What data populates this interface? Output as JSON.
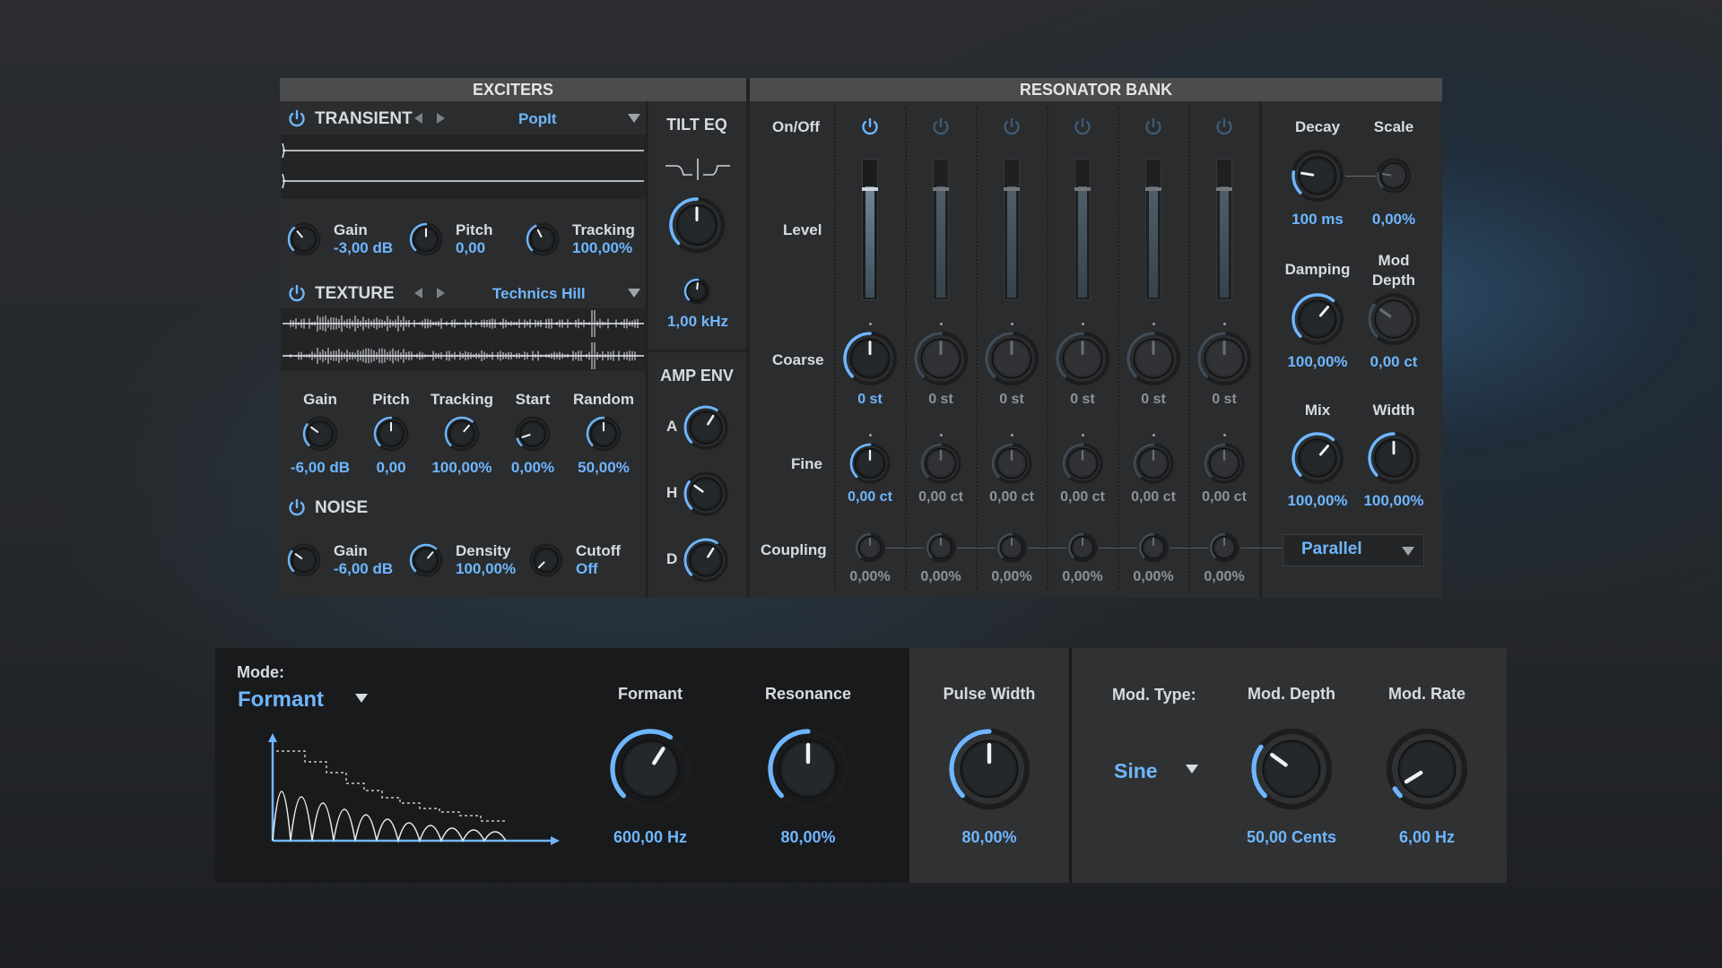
{
  "exciters": {
    "header": "EXCITERS",
    "transient": {
      "title": "TRANSIENT",
      "preset": "PopIt",
      "knobs": [
        {
          "name": "Gain",
          "value": "-3,00 dB",
          "level": 0.35
        },
        {
          "name": "Pitch",
          "value": "0,00",
          "level": 0.5
        },
        {
          "name": "Tracking",
          "value": "100,00%",
          "level": 0.4
        }
      ]
    },
    "texture": {
      "title": "TEXTURE",
      "preset": "Technics Hill",
      "knobs": [
        {
          "name": "Gain",
          "value": "-6,00 dB",
          "level": 0.3
        },
        {
          "name": "Pitch",
          "value": "0,00",
          "level": 0.5
        },
        {
          "name": "Tracking",
          "value": "100,00%",
          "level": 0.65
        },
        {
          "name": "Start",
          "value": "0,00%",
          "level": 0.1
        },
        {
          "name": "Random",
          "value": "50,00%",
          "level": 0.5
        }
      ]
    },
    "noise": {
      "title": "NOISE",
      "knobs": [
        {
          "name": "Gain",
          "value": "-6,00 dB",
          "level": 0.3
        },
        {
          "name": "Density",
          "value": "100,00%",
          "level": 0.65
        },
        {
          "name": "Cutoff",
          "value": "Off",
          "level": 0.0
        }
      ]
    }
  },
  "tilt_eq": {
    "title": "TILT EQ",
    "freq_value": "1,00 kHz"
  },
  "amp_env": {
    "title": "AMP ENV",
    "labels": [
      "A",
      "H",
      "D"
    ]
  },
  "resonator_bank": {
    "header": "RESONATOR BANK",
    "row_labels": {
      "onoff": "On/Off",
      "level": "Level",
      "coarse": "Coarse",
      "fine": "Fine",
      "coupling": "Coupling"
    },
    "channels": [
      {
        "coarse": "0 st",
        "fine": "0,00 ct",
        "coupling": "0,00%",
        "active": true
      },
      {
        "coarse": "0 st",
        "fine": "0,00 ct",
        "coupling": "0,00%",
        "active": false
      },
      {
        "coarse": "0 st",
        "fine": "0,00 ct",
        "coupling": "0,00%",
        "active": false
      },
      {
        "coarse": "0 st",
        "fine": "0,00 ct",
        "coupling": "0,00%",
        "active": false
      },
      {
        "coarse": "0 st",
        "fine": "0,00 ct",
        "coupling": "0,00%",
        "active": false
      },
      {
        "coarse": "0 st",
        "fine": "0,00 ct",
        "coupling": "0,00%",
        "active": false
      }
    ],
    "right": {
      "decay": {
        "label": "Decay",
        "value": "100 ms"
      },
      "scale": {
        "label": "Scale",
        "value": "0,00%"
      },
      "damping": {
        "label": "Damping",
        "value": "100,00%"
      },
      "mod_depth": {
        "label": "Mod Depth",
        "value": "0,00 ct"
      },
      "mix": {
        "label": "Mix",
        "value": "100,00%"
      },
      "width": {
        "label": "Width",
        "value": "100,00%"
      },
      "routing": "Parallel"
    }
  },
  "bottom": {
    "mode_label": "Mode:",
    "mode_value": "Formant",
    "formant": {
      "label": "Formant",
      "value": "600,00 Hz"
    },
    "resonance": {
      "label": "Resonance",
      "value": "80,00%"
    },
    "pulse_width": {
      "label": "Pulse Width",
      "value": "80,00%"
    },
    "mod_type": {
      "label": "Mod. Type:",
      "value": "Sine"
    },
    "mod_depth": {
      "label": "Mod. Depth",
      "value": "50,00 Cents"
    },
    "mod_rate": {
      "label": "Mod. Rate",
      "value": "6,00 Hz"
    }
  },
  "colors": {
    "accent": "#6fb6ff",
    "panel": "#2a2c2e",
    "header": "#4a4c4e"
  }
}
